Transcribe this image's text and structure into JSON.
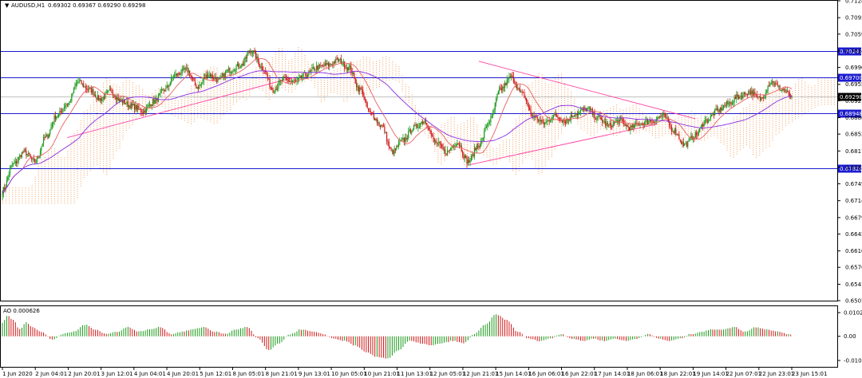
{
  "header": {
    "symbol": "AUDUSD,H1",
    "ohlc": "0.69302 0.69367 0.69290 0.69298"
  },
  "indicator": {
    "label": "AO 0.000626",
    "ticks": [
      "0.010241",
      "0.00",
      "-0.010443"
    ]
  },
  "colors": {
    "up": "#1a9a1a",
    "down": "#d01818",
    "level": "#1b1bd0",
    "ma_fast": "#e86060",
    "ma_slow": "#8a2be2",
    "trend": "#ff3fa0",
    "cloud": "#f0a060",
    "current_price": "#000000"
  },
  "chart_data": {
    "type": "candlestick",
    "symbol": "AUDUSD,H1",
    "ylim": [
      0.65073,
      0.71283
    ],
    "y_ticks": [
      "0.71283",
      "0.70933",
      "0.70593",
      "0.70243",
      "0.69903",
      "0.69553",
      "0.69213",
      "0.68863",
      "0.68523",
      "0.68173",
      "0.67833",
      "0.67493",
      "0.67143",
      "0.66793",
      "0.66453",
      "0.66103",
      "0.65763",
      "0.65413",
      "0.65073"
    ],
    "x_ticks": [
      "1 Jun 2020",
      "2 Jun 04:01",
      "2 Jun 20:01",
      "3 Jun 12:01",
      "4 Jun 04:01",
      "4 Jun 20:01",
      "5 Jun 12:01",
      "8 Jun 05:01",
      "8 Jun 21:01",
      "9 Jun 13:01",
      "10 Jun 05:01",
      "10 Jun 21:01",
      "11 Jun 13:01",
      "12 Jun 05:01",
      "12 Jun 21:01",
      "15 Jun 14:01",
      "16 Jun 06:01",
      "16 Jun 22:01",
      "17 Jun 14:01",
      "18 Jun 06:01",
      "18 Jun 22:01",
      "19 Jun 14:01",
      "22 Jun 07:01",
      "22 Jun 23:01",
      "23 Jun 15:01"
    ],
    "levels": [
      "0.70243",
      "0.69700",
      "0.68948",
      "0.67820"
    ],
    "current_price": "0.69298",
    "current_price_value": 0.69298,
    "anchors": [
      [
        0,
        0.6735
      ],
      [
        10,
        0.679
      ],
      [
        20,
        0.6815
      ],
      [
        30,
        0.6795
      ],
      [
        40,
        0.6845
      ],
      [
        50,
        0.689
      ],
      [
        60,
        0.6915
      ],
      [
        70,
        0.696
      ],
      [
        80,
        0.6945
      ],
      [
        90,
        0.6925
      ],
      [
        100,
        0.694
      ],
      [
        110,
        0.692
      ],
      [
        120,
        0.691
      ],
      [
        130,
        0.69
      ],
      [
        140,
        0.692
      ],
      [
        150,
        0.6945
      ],
      [
        160,
        0.6975
      ],
      [
        170,
        0.6985
      ],
      [
        180,
        0.695
      ],
      [
        190,
        0.6975
      ],
      [
        200,
        0.6965
      ],
      [
        210,
        0.6985
      ],
      [
        220,
        0.6995
      ],
      [
        230,
        0.7025
      ],
      [
        240,
        0.699
      ],
      [
        250,
        0.6945
      ],
      [
        260,
        0.6965
      ],
      [
        270,
        0.696
      ],
      [
        280,
        0.6975
      ],
      [
        290,
        0.699
      ],
      [
        300,
        0.6995
      ],
      [
        310,
        0.7005
      ],
      [
        320,
        0.699
      ],
      [
        330,
        0.6945
      ],
      [
        340,
        0.6895
      ],
      [
        350,
        0.687
      ],
      [
        360,
        0.6815
      ],
      [
        370,
        0.684
      ],
      [
        380,
        0.6865
      ],
      [
        390,
        0.688
      ],
      [
        400,
        0.6835
      ],
      [
        410,
        0.6815
      ],
      [
        420,
        0.6835
      ],
      [
        430,
        0.6795
      ],
      [
        440,
        0.683
      ],
      [
        450,
        0.688
      ],
      [
        460,
        0.6945
      ],
      [
        470,
        0.697
      ],
      [
        480,
        0.6935
      ],
      [
        490,
        0.689
      ],
      [
        500,
        0.6875
      ],
      [
        510,
        0.689
      ],
      [
        520,
        0.688
      ],
      [
        530,
        0.6895
      ],
      [
        540,
        0.6905
      ],
      [
        550,
        0.6885
      ],
      [
        560,
        0.687
      ],
      [
        570,
        0.688
      ],
      [
        580,
        0.6865
      ],
      [
        590,
        0.6875
      ],
      [
        600,
        0.688
      ],
      [
        610,
        0.689
      ],
      [
        620,
        0.686
      ],
      [
        630,
        0.683
      ],
      [
        640,
        0.685
      ],
      [
        650,
        0.688
      ],
      [
        660,
        0.69
      ],
      [
        670,
        0.6915
      ],
      [
        680,
        0.693
      ],
      [
        690,
        0.694
      ],
      [
        700,
        0.6925
      ],
      [
        710,
        0.696
      ],
      [
        720,
        0.6945
      ],
      [
        730,
        0.6929
      ]
    ],
    "ao_profile": [
      [
        0,
        0.006
      ],
      [
        5,
        0.009
      ],
      [
        10,
        0.007
      ],
      [
        16,
        0.003
      ],
      [
        22,
        0.006
      ],
      [
        28,
        0.004
      ],
      [
        36,
        0.002
      ],
      [
        46,
        -0.0015
      ],
      [
        56,
        0.001
      ],
      [
        66,
        0.002
      ],
      [
        76,
        0.005
      ],
      [
        86,
        0.003
      ],
      [
        96,
        0.001
      ],
      [
        106,
        0.002
      ],
      [
        116,
        0.004
      ],
      [
        126,
        0.002
      ],
      [
        136,
        0.003
      ],
      [
        146,
        0.004
      ],
      [
        156,
        0.001
      ],
      [
        166,
        0.002
      ],
      [
        176,
        0.003
      ],
      [
        186,
        0.004
      ],
      [
        196,
        0.002
      ],
      [
        206,
        0.001
      ],
      [
        216,
        0.003
      ],
      [
        226,
        0.004
      ],
      [
        236,
        -0.001
      ],
      [
        246,
        -0.006
      ],
      [
        256,
        -0.003
      ],
      [
        266,
        0.001
      ],
      [
        276,
        0.003
      ],
      [
        286,
        0.002
      ],
      [
        296,
        0.001
      ],
      [
        306,
        -0.001
      ],
      [
        316,
        -0.002
      ],
      [
        326,
        -0.004
      ],
      [
        336,
        -0.007
      ],
      [
        346,
        -0.009
      ],
      [
        356,
        -0.0095
      ],
      [
        366,
        -0.006
      ],
      [
        376,
        -0.002
      ],
      [
        386,
        -0.003
      ],
      [
        396,
        -0.004
      ],
      [
        406,
        -0.003
      ],
      [
        416,
        -0.002
      ],
      [
        426,
        -0.003
      ],
      [
        436,
        0.001
      ],
      [
        446,
        0.005
      ],
      [
        456,
        0.0095
      ],
      [
        466,
        0.007
      ],
      [
        476,
        0.002
      ],
      [
        486,
        -0.001
      ],
      [
        496,
        -0.002
      ],
      [
        506,
        -0.001
      ],
      [
        516,
        0.001
      ],
      [
        526,
        -0.001
      ],
      [
        536,
        -0.002
      ],
      [
        546,
        -0.001
      ],
      [
        556,
        -0.002
      ],
      [
        566,
        -0.001
      ],
      [
        576,
        -0.002
      ],
      [
        586,
        -0.001
      ],
      [
        596,
        0.001
      ],
      [
        606,
        -0.001
      ],
      [
        616,
        -0.002
      ],
      [
        626,
        -0.001
      ],
      [
        636,
        0.001
      ],
      [
        646,
        0.002
      ],
      [
        656,
        0.003
      ],
      [
        666,
        0.003
      ],
      [
        676,
        0.004
      ],
      [
        686,
        0.002
      ],
      [
        696,
        0.004
      ],
      [
        706,
        0.003
      ],
      [
        716,
        0.002
      ],
      [
        730,
        0.0005
      ]
    ],
    "n_bars": 730
  }
}
